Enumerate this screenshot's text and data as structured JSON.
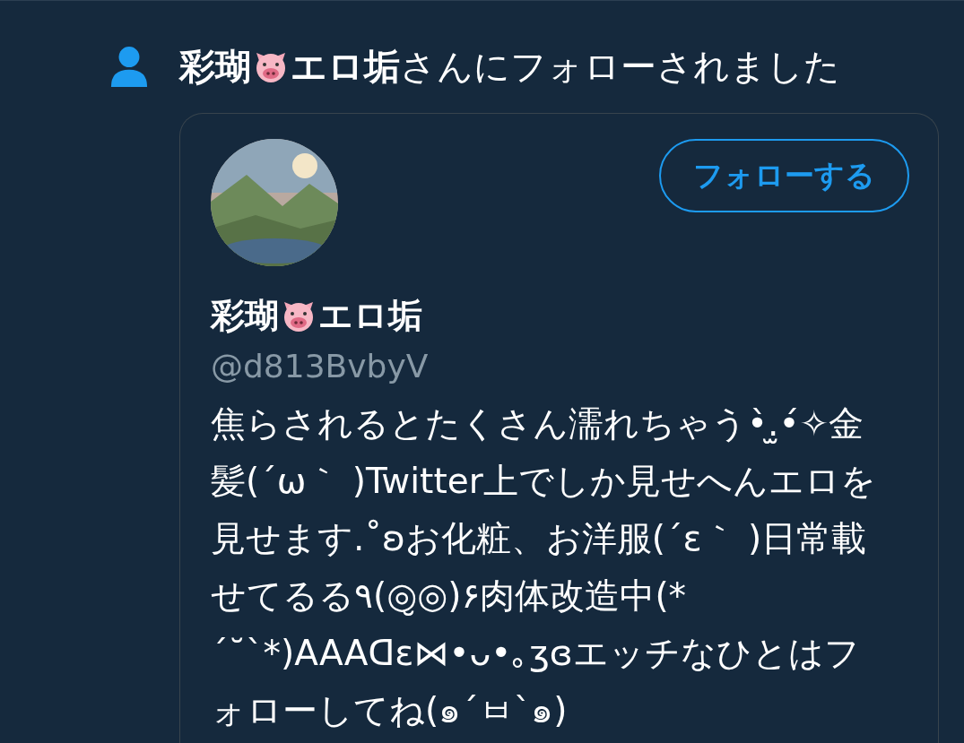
{
  "notification": {
    "name_start": "彩瑚",
    "name_end": "エロ垢",
    "message": "さんにフォローされました"
  },
  "card": {
    "follow_button": "フォローする",
    "name_start": "彩瑚",
    "name_end": "エロ垢",
    "handle": "@d813BvbyV",
    "bio": "焦らされるとたくさん濡れちゃう•̀.̫•́✧金髪(´ω｀ )Twitter上でしか見せへんエロを見せます.˚ʚお化粧、お洋服(´ε｀ )日常載せてるる٩(◎̮◎)۶肉体改造中(*´˘`*)AAAᗡɛ⋈•ᴗ•｡ʒɞエッチなひとはフォローしてね(๑´ㅂ`๑)"
  }
}
